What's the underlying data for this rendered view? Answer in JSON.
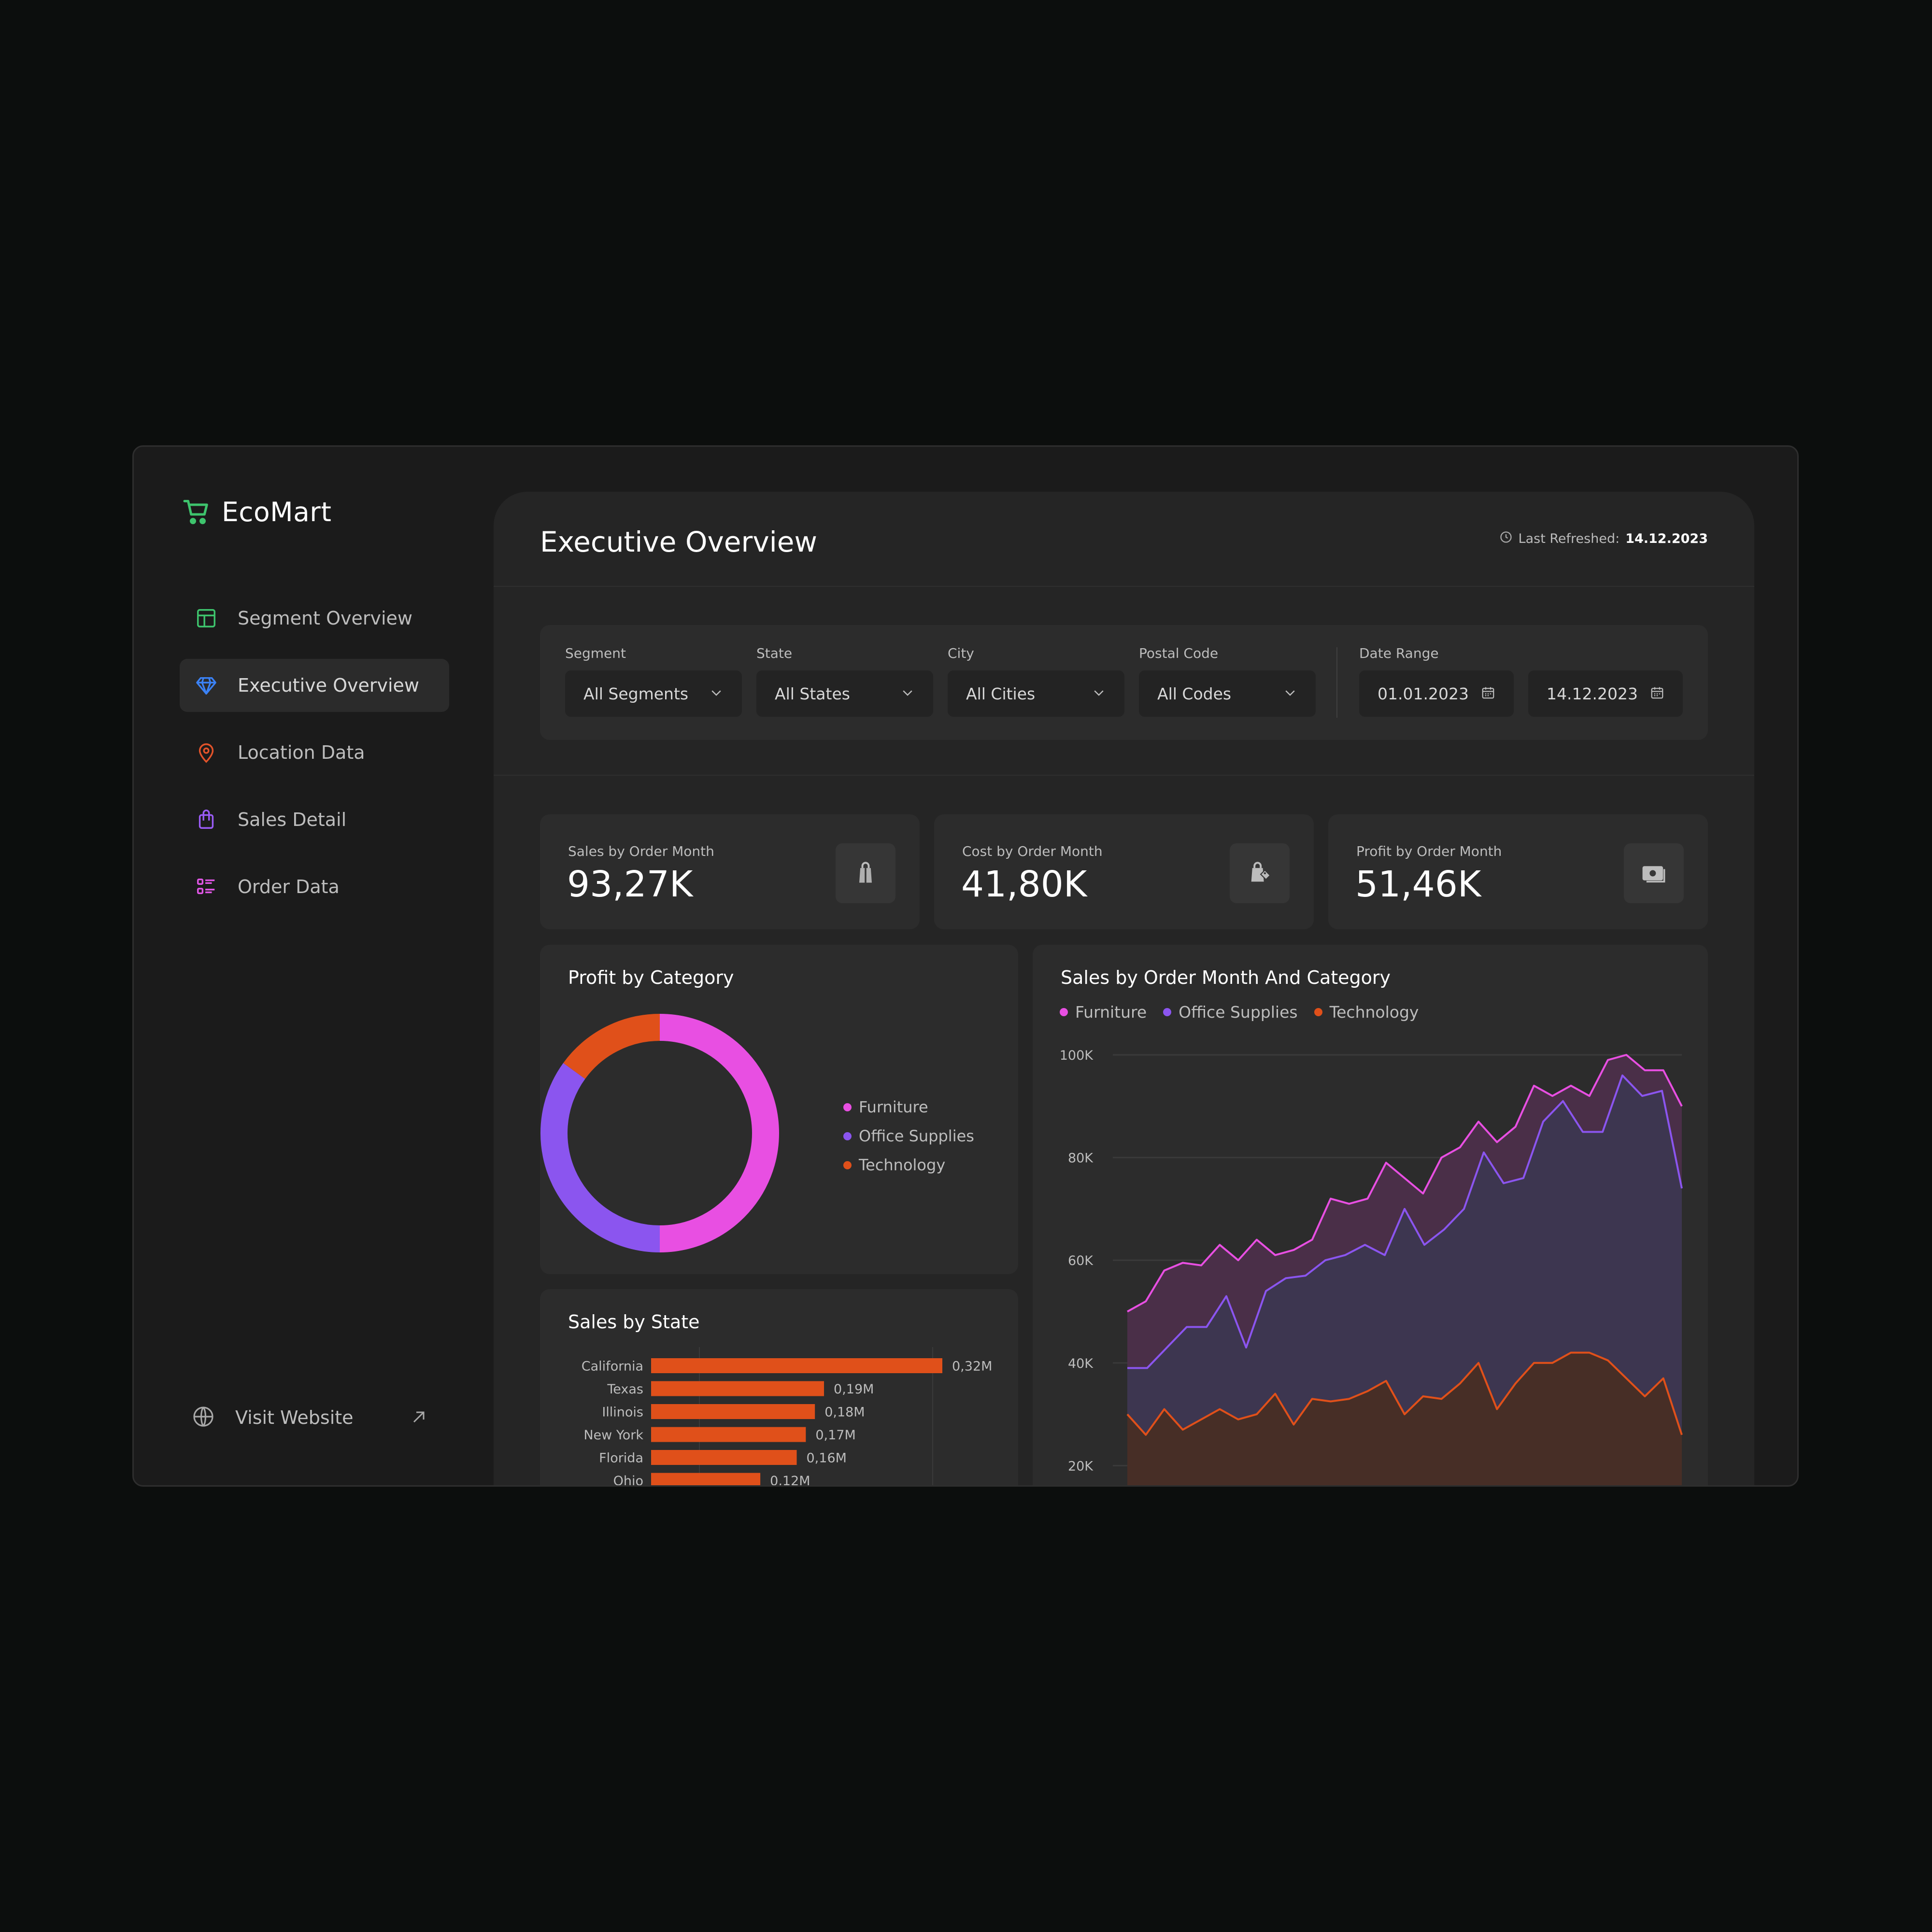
{
  "brand": {
    "name": "EcoMart",
    "icon": "shopping-cart-icon",
    "color": "#3ec46d"
  },
  "sidebar": {
    "items": [
      {
        "label": "Segment Overview",
        "icon": "layout-icon",
        "color": "#3ec46d",
        "active": false
      },
      {
        "label": "Executive Overview",
        "icon": "diamond-icon",
        "color": "#3b82f6",
        "active": true
      },
      {
        "label": "Location Data",
        "icon": "map-pin-icon",
        "color": "#e2532a",
        "active": false
      },
      {
        "label": "Sales Detail",
        "icon": "shopping-bag-icon",
        "color": "#9b5cf6",
        "active": false
      },
      {
        "label": "Order Data",
        "icon": "list-icon",
        "color": "#e056e6",
        "active": false
      }
    ],
    "visit": {
      "label": "Visit Website",
      "icon": "globe-icon",
      "ext_icon": "external-arrow-icon"
    }
  },
  "header": {
    "title": "Executive Overview",
    "refresh_label": "Last Refreshed:",
    "refresh_date": "14.12.2023"
  },
  "filters": {
    "segment": {
      "label": "Segment",
      "value": "All Segments"
    },
    "state": {
      "label": "State",
      "value": "All States"
    },
    "city": {
      "label": "City",
      "value": "All Cities"
    },
    "postal": {
      "label": "Postal Code",
      "value": "All Codes"
    },
    "date_range": {
      "label": "Date Range",
      "start": "01.01.2023",
      "end": "14.12.2023"
    }
  },
  "kpis": [
    {
      "label": "Sales by Order Month",
      "value": "93,27K",
      "icon": "shopping-bags-icon"
    },
    {
      "label": "Cost by Order Month",
      "value": "41,80K",
      "icon": "price-tag-bag-icon"
    },
    {
      "label": "Profit by Order Month",
      "value": "51,46K",
      "icon": "money-icon"
    }
  ],
  "colors": {
    "furniture": "#e84fe2",
    "office": "#8b55ef",
    "technology": "#e0501a"
  },
  "chart_data": [
    {
      "type": "pie",
      "title": "Profit by Category",
      "labels": [
        "Furniture",
        "Office Supplies",
        "Technology"
      ],
      "values": [
        50,
        35,
        15
      ],
      "legend": "right"
    },
    {
      "type": "area",
      "title": "Sales by Order Month And Category",
      "legend": "top-left",
      "yticks": [
        "100K",
        "80K",
        "60K",
        "40K",
        "20K"
      ],
      "ylim": [
        0,
        100000
      ],
      "grid": true,
      "series": [
        {
          "name": "Furniture",
          "values": [
            50000,
            52000,
            58000,
            59500,
            59000,
            63000,
            60000,
            64000,
            61000,
            62000,
            64000,
            72000,
            71000,
            72000,
            79000,
            76000,
            73000,
            80000,
            82000,
            87000,
            83000,
            86000,
            94000,
            92000,
            94000,
            92000,
            99000,
            100000,
            97000,
            97000,
            90000
          ]
        },
        {
          "name": "Office Supplies",
          "values": [
            39000,
            39000,
            43000,
            47000,
            47000,
            53000,
            43000,
            54000,
            56500,
            57000,
            60000,
            61000,
            63000,
            61000,
            70000,
            63000,
            66000,
            70000,
            81000,
            75000,
            76000,
            87000,
            91000,
            85000,
            85000,
            96000,
            92000,
            93000,
            74000
          ]
        },
        {
          "name": "Technology",
          "values": [
            30000,
            26000,
            31000,
            27000,
            29000,
            31000,
            29000,
            30000,
            34000,
            28000,
            33000,
            32500,
            33000,
            34500,
            36500,
            30000,
            33500,
            33000,
            36000,
            40000,
            31000,
            36000,
            40000,
            40000,
            42000,
            42000,
            40500,
            37000,
            33500,
            37000,
            26000
          ]
        }
      ]
    },
    {
      "type": "bar",
      "title": "Sales by State",
      "orientation": "horizontal",
      "categories": [
        "California",
        "Texas",
        "Illinois",
        "New York",
        "Florida",
        "Ohio"
      ],
      "values": [
        0.32,
        0.19,
        0.18,
        0.17,
        0.16,
        0.12
      ],
      "value_labels": [
        "0,32M",
        "0,19M",
        "0,18M",
        "0,17M",
        "0,16M",
        "0,12M"
      ]
    }
  ]
}
